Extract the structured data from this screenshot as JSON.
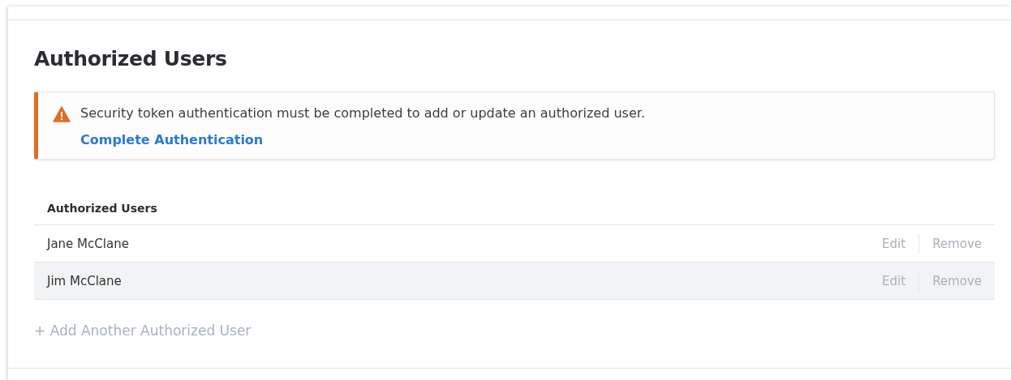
{
  "title": "Authorized Users",
  "alert": {
    "kind": "warning",
    "message": "Security token authentication must be completed to add or update an authorized user.",
    "link": "Complete Authentication"
  },
  "table": {
    "columns": [
      "Authorized Users"
    ],
    "rows": [
      {
        "name": "Jane McClane",
        "highlighted": false,
        "actions": [
          {
            "label": "Edit",
            "disabled": true
          },
          {
            "label": "Remove",
            "disabled": true
          }
        ]
      },
      {
        "name": "Jim McClane",
        "highlighted": true,
        "actions": [
          {
            "label": "Edit",
            "disabled": true
          },
          {
            "label": "Remove",
            "disabled": true
          }
        ]
      }
    ]
  },
  "add_link": {
    "label": "+ Add Another Authorized User",
    "disabled": true
  }
}
